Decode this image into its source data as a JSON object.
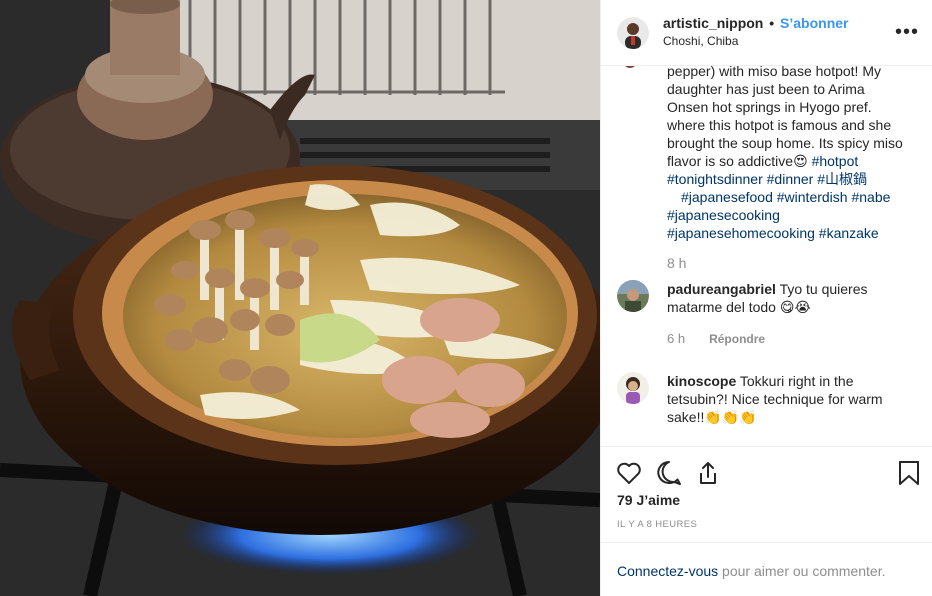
{
  "post": {
    "username": "artistic_nippon",
    "separator": "•",
    "follow_label": "S’abonner",
    "location": "Choshi, Chiba",
    "more_label": "•••"
  },
  "caption": {
    "lines": [
      "pepper) with miso base hotpot! My",
      "daughter has just been to Arima",
      "Onsen hot springs in Hyogo pref.",
      "where this hotpot is famous and she",
      "brought the soup home. Its spicy miso"
    ],
    "line_last_prefix": "flavor is so addictive",
    "emoji_heart_eyes": "😍",
    "tags": [
      "#hotpot",
      "#tonightsdinner",
      "#dinner",
      "#山椒鍋",
      "#japanesefood",
      "#winterdish",
      "#nabe",
      "#japanesecooking",
      "#japanesehomecooking",
      "#kanzake"
    ],
    "time": "8 h"
  },
  "comments": [
    {
      "username": "padureangabriel",
      "text": "Tyo tu quieres matarme del todo",
      "emoji": "😋😭",
      "time": "6 h",
      "reply_label": "Répondre"
    },
    {
      "username": "kinoscope",
      "text": "Tokkuri right in the tetsubin?! Nice technique for warm sake!!",
      "emoji": "👏👏👏"
    }
  ],
  "actions": {
    "like_icon": "heart-icon",
    "comment_icon": "comment-bubble-icon",
    "share_icon": "share-icon",
    "save_icon": "bookmark-icon",
    "likes": "79 J’aime",
    "posted_ago": "IL Y A 8 HEURES"
  },
  "footer": {
    "login_link": "Connectez-vous",
    "rest": " pour aimer ou commenter."
  },
  "colors": {
    "link_blue": "#3897f0",
    "hashtag": "#003569",
    "muted": "#8e8e8e",
    "divider": "#efefef"
  }
}
